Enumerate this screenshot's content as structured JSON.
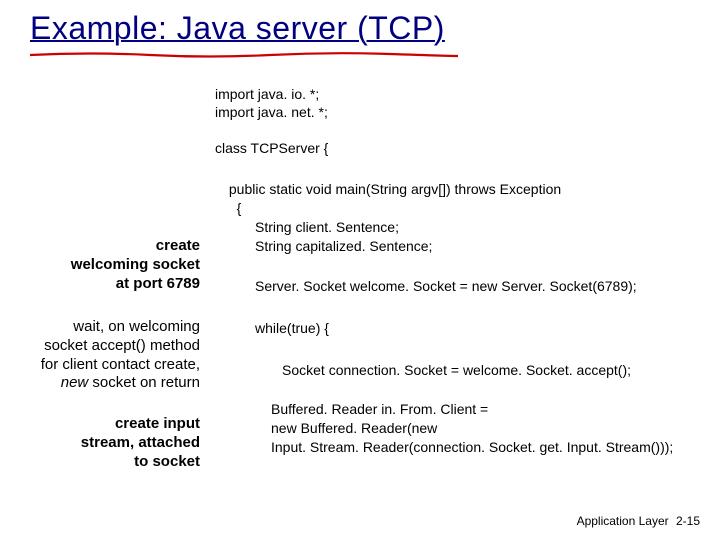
{
  "title": "Example: Java server (TCP)",
  "code": {
    "import1": "import java. io. *;",
    "import2": "import java. net. *;",
    "classdecl": "class TCPServer {",
    "mainline": " public static void main(String argv[]) throws Exception\n   {",
    "l1": "String client. Sentence;",
    "l2": "String capitalized. Sentence;",
    "l3": "Server. Socket welcome. Socket = new Server. Socket(6789);",
    "l4": "while(true) {",
    "l5": "Socket connection. Socket = welcome. Socket. accept();",
    "l6a": "Buffered. Reader in. From. Client =",
    "l6b": "  new Buffered. Reader(new",
    "l6c": "  Input. Stream. Reader(connection. Socket. get. Input. Stream()));"
  },
  "anno": {
    "a1l1": "create",
    "a1l2": "welcoming socket",
    "a1l3": "at port 6789",
    "a2l1": "wait, on welcoming",
    "a2l2": "socket accept() method",
    "a2l3": "for client contact create,",
    "a2l4a": "new",
    "a2l4b": " socket on return",
    "a3l1": "create input",
    "a3l2": "stream, attached",
    "a3l3": "to socket"
  },
  "footer": {
    "label": "Application Layer",
    "page": "2-15"
  }
}
